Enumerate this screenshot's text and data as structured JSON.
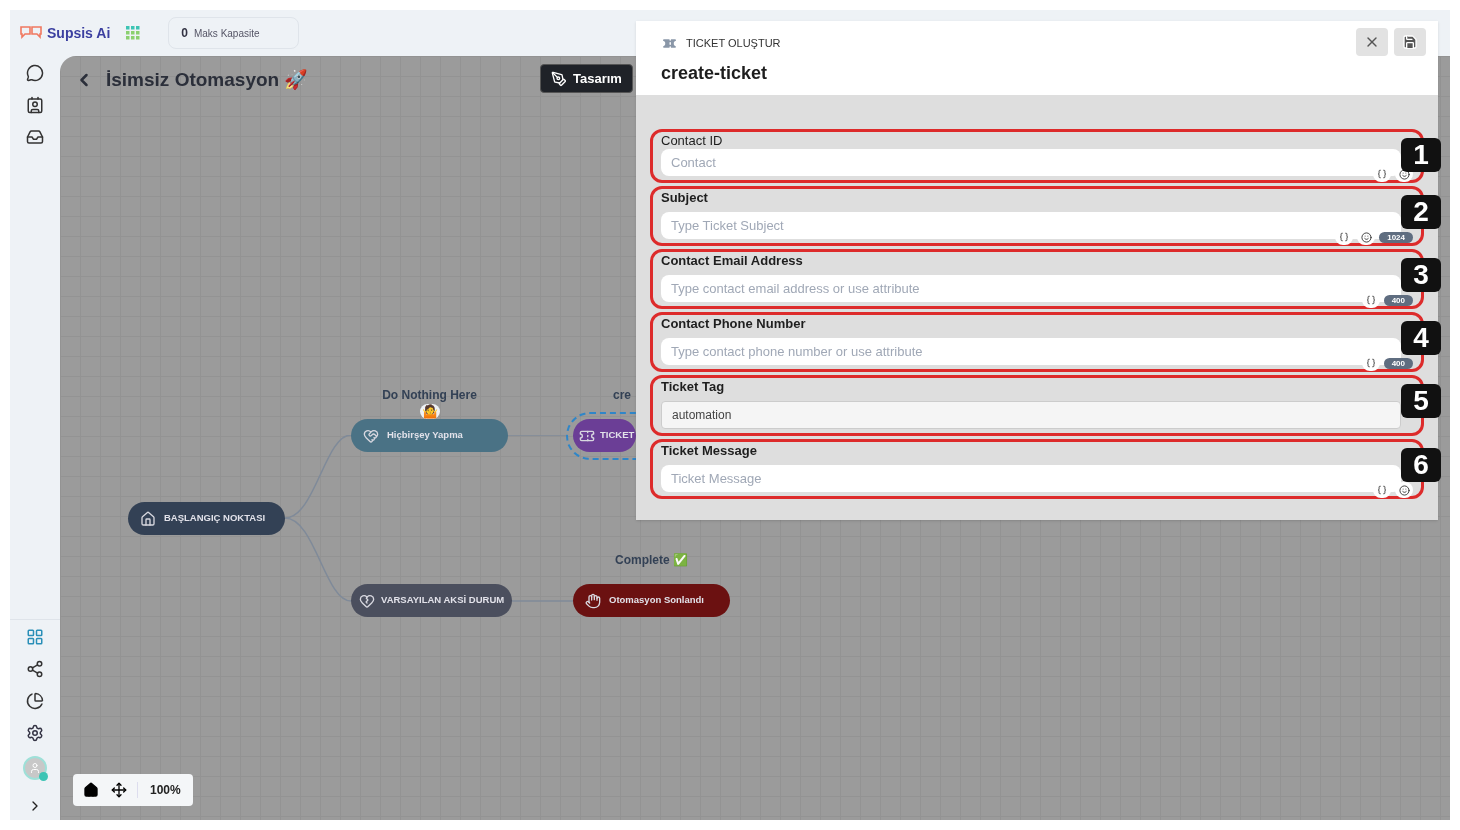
{
  "brand": {
    "name": "Supsis Ai"
  },
  "capacity": {
    "count": "0",
    "label": "Maks Kapasite"
  },
  "canvas": {
    "title": "İsimsiz Otomasyon 🚀",
    "design_button": "Tasarım",
    "zoom": "100%",
    "nodes": [
      {
        "kind": "start",
        "label": "BAŞLANGIÇ NOKTASI",
        "color": "#334155"
      },
      {
        "kind": "action",
        "label": "Hiçbirşey Yapma",
        "color": "#4a7285",
        "caption": "Do Nothing Here",
        "caption_emoji": "🤷"
      },
      {
        "kind": "ticket",
        "label": "TICKET",
        "color": "#6b3e96",
        "caption": "cre",
        "dashed": true
      },
      {
        "kind": "fallback",
        "label": "VARSAYILAN AKSİ DURUM",
        "color": "#4b4f5e"
      },
      {
        "kind": "end",
        "label": "Otomasyon Sonlandı",
        "color": "#6b1111",
        "caption": "Complete ✅"
      }
    ]
  },
  "panel": {
    "type_label": "TICKET OLUŞTUR",
    "name": "create-ticket",
    "fields": [
      {
        "kind": "input",
        "label": "Contact ID",
        "label_bold": false,
        "placeholder": "Contact",
        "variable_button": true,
        "emoji_button": true,
        "marker": "1"
      },
      {
        "kind": "input",
        "label": "Subject",
        "label_bold": true,
        "placeholder": "Type Ticket Subject",
        "variable_button": true,
        "emoji_button": true,
        "count": "1024",
        "marker": "2"
      },
      {
        "kind": "input",
        "label": "Contact Email Address",
        "label_bold": true,
        "placeholder": "Type contact email address or use attribute",
        "variable_button": true,
        "emoji_button": false,
        "count": "400",
        "marker": "3"
      },
      {
        "kind": "input",
        "label": "Contact Phone Number",
        "label_bold": true,
        "placeholder": "Type contact phone number or use attribute",
        "variable_button": true,
        "emoji_button": false,
        "count": "400",
        "marker": "4"
      },
      {
        "kind": "tag",
        "label": "Ticket Tag",
        "label_bold": true,
        "value": "automation",
        "marker": "5"
      },
      {
        "kind": "input",
        "label": "Ticket Message",
        "label_bold": true,
        "placeholder": "Ticket Message",
        "variable_button": true,
        "emoji_button": true,
        "marker": "6"
      }
    ]
  }
}
